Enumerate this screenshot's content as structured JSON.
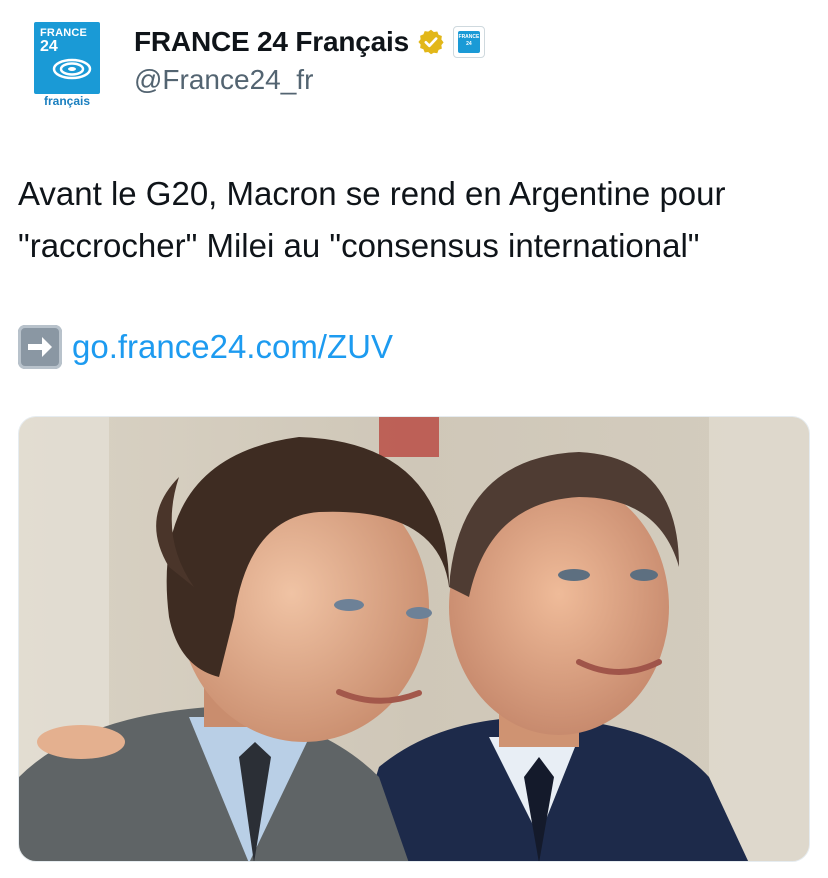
{
  "header": {
    "avatar": {
      "brand_line1": "FRANCE",
      "brand_line2": "24",
      "language": "français"
    },
    "display_name": "FRANCE 24 Français",
    "verified_icon": "gold-verified-badge-icon",
    "affiliation_icon": "france24-affiliate-badge-icon",
    "affiliation_text": "FRANCE 24",
    "handle": "@France24_fr"
  },
  "tweet": {
    "text": "Avant le G20, Macron se rend en Argentine pour \"raccrocher\" Milei au \"consensus international\"",
    "link_icon": "right-arrow-emoji-icon",
    "link_text": "go.france24.com/ZUV"
  },
  "media": {
    "type": "photo",
    "icon": "photo-two-men-smiling-icon"
  },
  "colors": {
    "text": "#0f1419",
    "secondary_text": "#536471",
    "link": "#1d9bf0",
    "verified_gold": "#e2b719",
    "brand_blue": "#1a9ad6"
  }
}
